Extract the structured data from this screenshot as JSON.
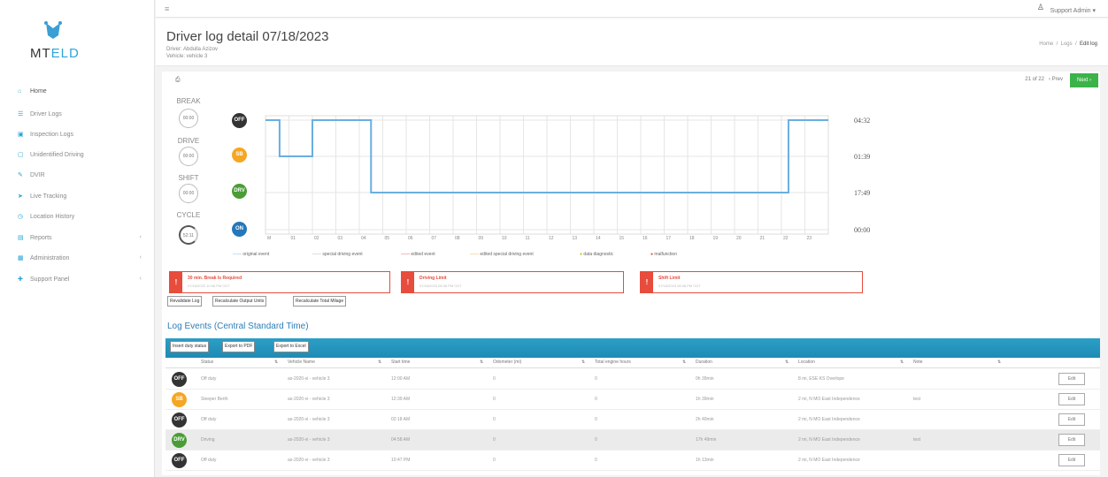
{
  "brand": {
    "logo_text_a": "MT",
    "logo_text_b": "ELD",
    "accent": "#27a3d6"
  },
  "nav": [
    {
      "label": "Home",
      "icon": "home-icon"
    },
    {
      "label": "Driver Logs",
      "icon": "list-icon"
    },
    {
      "label": "Inspection Logs",
      "icon": "truck-icon"
    },
    {
      "label": "Unidentified Driving",
      "icon": "question-icon"
    },
    {
      "label": "DVIR",
      "icon": "wrench-icon"
    },
    {
      "label": "Live Tracking",
      "icon": "location-icon"
    },
    {
      "label": "Location History",
      "icon": "history-icon"
    },
    {
      "label": "Reports",
      "icon": "chart-icon"
    },
    {
      "label": "Administration",
      "icon": "admin-icon"
    },
    {
      "label": "Support Panel",
      "icon": "support-icon"
    }
  ],
  "topbar": {
    "user": "Support Admin ▾"
  },
  "header": {
    "title": "Driver log detail 07/18/2023",
    "driver": "Driver: Abdulla Azizov",
    "vehicle": "Vehicle: vehicle 3",
    "breadcrumb": {
      "home": "Home",
      "logs": "Logs",
      "current": "Edit log"
    }
  },
  "pager": {
    "count": "21 of 22",
    "prev": "‹ Prev",
    "next": "Next ›"
  },
  "counters": [
    {
      "label": "BREAK",
      "value": "00:00"
    },
    {
      "label": "DRIVE",
      "value": "00:00"
    },
    {
      "label": "SHIFT",
      "value": "00:00"
    },
    {
      "label": "CYCLE",
      "value": "52:11"
    }
  ],
  "statuses": [
    "OFF",
    "SB",
    "DRV",
    "ON"
  ],
  "colors": {
    "off": "#333333",
    "sb": "#f5a623",
    "drv": "#4a9d36",
    "on": "#2478b9",
    "line": "#6aaee0",
    "alert": "#e74c3c"
  },
  "chart_data": {
    "type": "line",
    "x_ticks": [
      "M",
      "01",
      "02",
      "03",
      "04",
      "05",
      "06",
      "07",
      "08",
      "09",
      "10",
      "11",
      "12",
      "13",
      "14",
      "15",
      "16",
      "17",
      "18",
      "19",
      "20",
      "21",
      "22",
      "23"
    ],
    "y_categories": [
      "OFF",
      "SB",
      "DRV",
      "ON"
    ],
    "totals": [
      "04:32",
      "01:39",
      "17:49",
      "00:00"
    ],
    "original_event": {
      "x_hours": [
        0,
        0.6,
        0.6,
        2.0,
        2.0,
        4.5,
        4.5,
        22.3,
        22.3,
        24
      ],
      "status": [
        "OFF",
        "OFF",
        "SB",
        "SB",
        "OFF",
        "OFF",
        "DRV",
        "DRV",
        "OFF",
        "OFF"
      ]
    },
    "legend": [
      "original event",
      "special driving event",
      "edited event",
      "edited special driving event",
      "data diagnostic",
      "malfunction"
    ],
    "legend_colors": [
      "#6aaee0",
      "#aaaaaa",
      "#e74c3c",
      "#f5a623",
      "#d4c200",
      "#e74c3c"
    ]
  },
  "alerts": [
    {
      "title": "30 min. Break Is Required",
      "date": "07/18/2023 10:08 PM CDT"
    },
    {
      "title": "Driving Limit",
      "date": "07/18/2023 08:08 PM CDT"
    },
    {
      "title": "Shift Limit",
      "date": "07/18/2023 08:08 PM CDT"
    }
  ],
  "actions": [
    "Revalidate Log",
    "Recalculate Output Units",
    "Recalculate Total Milage"
  ],
  "section_title": "Log Events (Central Standard Time)",
  "table_buttons": [
    "Insert duty status",
    "Export to PDF",
    "Export to Excel"
  ],
  "columns": [
    "Status",
    "Vehicle Name",
    "Start time",
    "Odometer (mi)",
    "Total engine hours",
    "Duration",
    "Location",
    "Note"
  ],
  "rows": [
    {
      "status": "OFF",
      "status_label": "Off duty",
      "vehicle": "as-2020-vi - vehicle 3",
      "start": "12:00 AM",
      "odo": "0",
      "eng": "0",
      "dur": "0h 39min",
      "loc": "8 mi, ESE KS Overlope",
      "note": "",
      "edit": "Edit"
    },
    {
      "status": "SB",
      "status_label": "Sleeper Berth",
      "vehicle": "as-2020-vi - vehicle 3",
      "start": "12:39 AM",
      "odo": "0",
      "eng": "0",
      "dur": "1h 39min",
      "loc": "2 mi, N MO East Independence",
      "note": "test",
      "edit": "Edit"
    },
    {
      "status": "OFF",
      "status_label": "Off duty",
      "vehicle": "as-2020-vi - vehicle 3",
      "start": "02:18 AM",
      "odo": "0",
      "eng": "0",
      "dur": "2h 40min",
      "loc": "2 mi, N MO East Independence",
      "note": "",
      "edit": "Edit"
    },
    {
      "status": "DRV",
      "status_label": "Driving",
      "vehicle": "as-2020-vi - vehicle 3",
      "start": "04:58 AM",
      "odo": "0",
      "eng": "0",
      "dur": "17h 49min",
      "loc": "2 mi, N MO East Independence",
      "note": "test",
      "edit": "Edit"
    },
    {
      "status": "OFF",
      "status_label": "Off duty",
      "vehicle": "as-2020-vi - vehicle 3",
      "start": "10:47 PM",
      "odo": "0",
      "eng": "0",
      "dur": "1h 13min",
      "loc": "2 mi, N MO East Independence",
      "note": "",
      "edit": "Edit"
    }
  ]
}
